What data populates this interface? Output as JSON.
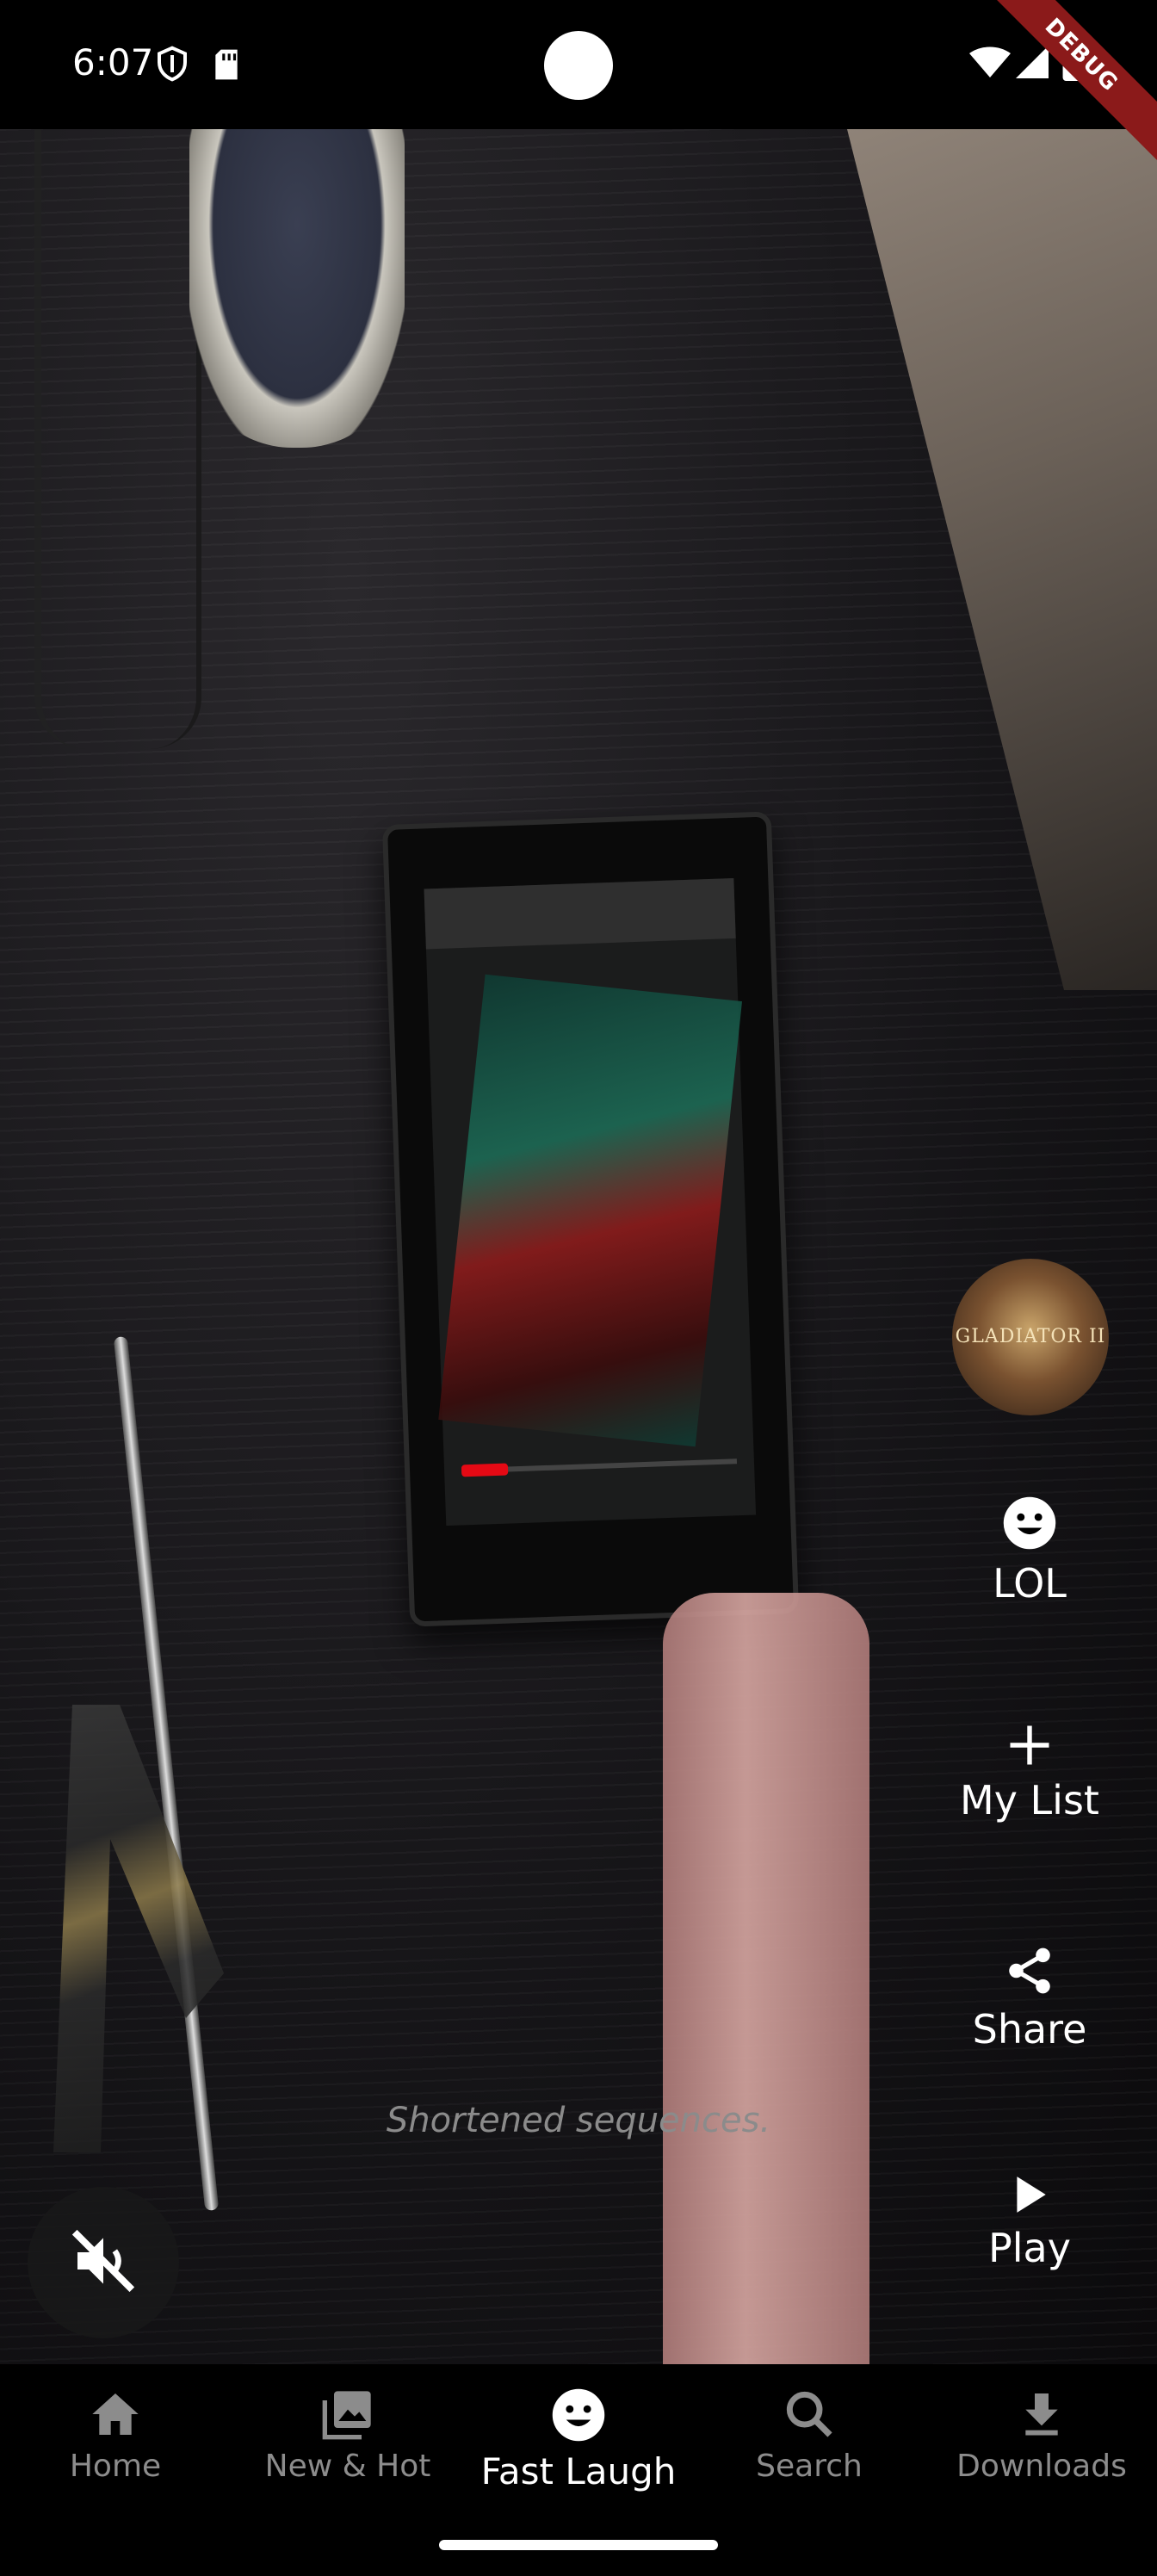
{
  "status_bar": {
    "time": "6:07",
    "debug_label": "DEBUG"
  },
  "video": {
    "caption": "Shortened sequences."
  },
  "side_actions": {
    "poster_title": "GLADIATOR II",
    "lol_label": "LOL",
    "my_list_label": "My List",
    "share_label": "Share",
    "play_label": "Play"
  },
  "bottom_nav": {
    "items": [
      {
        "label": "Home",
        "icon": "home-icon"
      },
      {
        "label": "New & Hot",
        "icon": "collections-icon"
      },
      {
        "label": "Fast Laugh",
        "icon": "smiley-icon",
        "active": true
      },
      {
        "label": "Search",
        "icon": "search-icon"
      },
      {
        "label": "Downloads",
        "icon": "download-icon"
      }
    ]
  },
  "colors": {
    "background": "#000000",
    "active_text": "#ffffff",
    "inactive_text": "#8c8c8c",
    "debug_ribbon": "#8b1a1a"
  }
}
